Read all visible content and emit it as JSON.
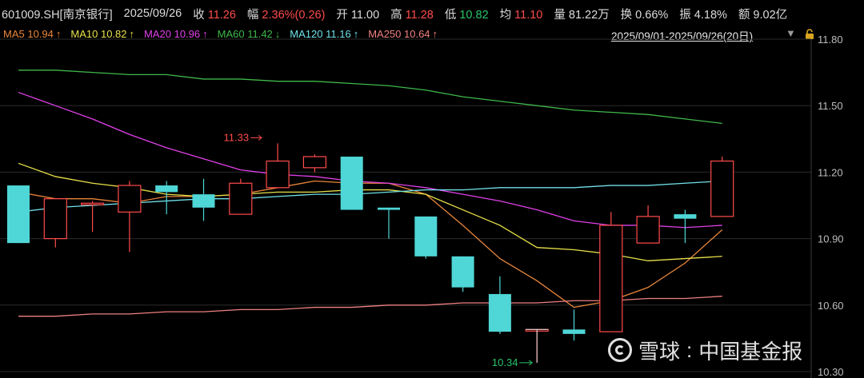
{
  "header": {
    "code": "601009.SH[南京银行]",
    "date": "2025/09/26",
    "close_label": "收",
    "close": "11.26",
    "change_label": "幅",
    "change": "2.36%(0.26)",
    "open_label": "开",
    "open": "11.00",
    "high_label": "高",
    "high": "11.28",
    "low_label": "低",
    "low": "10.82",
    "avg_label": "均",
    "avg": "11.10",
    "volume_label": "量",
    "volume": "81.22万",
    "turnover_label": "换",
    "turnover": "0.66%",
    "amplitude_label": "振",
    "amplitude": "4.18%",
    "amount_label": "额",
    "amount": "9.02亿"
  },
  "ma_legend": [
    {
      "label": "MA5",
      "value": "10.94",
      "arrow": "↑",
      "color": "#e8853a"
    },
    {
      "label": "MA10",
      "value": "10.82",
      "arrow": "↑",
      "color": "#e8e04a"
    },
    {
      "label": "MA20",
      "value": "10.96",
      "arrow": "↑",
      "color": "#e040e8"
    },
    {
      "label": "MA60",
      "value": "11.42",
      "arrow": "↓",
      "color": "#3fb84a"
    },
    {
      "label": "MA120",
      "value": "11.16",
      "arrow": "↑",
      "color": "#6fe0e8"
    },
    {
      "label": "MA250",
      "value": "10.64",
      "arrow": "↑",
      "color": "#f08080"
    }
  ],
  "range_label": "2025/09/01-2025/09/26(20日)",
  "watermark": {
    "brand": "雪球",
    "separator": ":",
    "source": "中国基金报"
  },
  "colors": {
    "up": "#ff4b4b",
    "down": "#4fd6d6",
    "grid": "#2a2a2a",
    "axis_text": "#bdbdbd"
  },
  "chart_data": {
    "type": "candlestick",
    "y_ticks": [
      11.8,
      11.5,
      11.2,
      10.9,
      10.6,
      10.3
    ],
    "ylim": [
      10.3,
      11.8
    ],
    "candles": [
      {
        "o": 11.14,
        "h": 11.14,
        "l": 10.88,
        "c": 10.88
      },
      {
        "o": 10.9,
        "h": 11.08,
        "l": 10.86,
        "c": 11.08
      },
      {
        "o": 11.06,
        "h": 11.07,
        "l": 10.93,
        "c": 11.06
      },
      {
        "o": 11.02,
        "h": 11.16,
        "l": 10.84,
        "c": 11.14
      },
      {
        "o": 11.14,
        "h": 11.16,
        "l": 11.01,
        "c": 11.11
      },
      {
        "o": 11.1,
        "h": 11.17,
        "l": 10.98,
        "c": 11.04
      },
      {
        "o": 11.01,
        "h": 11.17,
        "l": 11.01,
        "c": 11.15
      },
      {
        "o": 11.13,
        "h": 11.33,
        "l": 11.13,
        "c": 11.25
      },
      {
        "o": 11.22,
        "h": 11.28,
        "l": 11.2,
        "c": 11.27
      },
      {
        "o": 11.27,
        "h": 11.27,
        "l": 11.03,
        "c": 11.03
      },
      {
        "o": 11.04,
        "h": 11.04,
        "l": 10.9,
        "c": 11.03
      },
      {
        "o": 11.0,
        "h": 11.0,
        "l": 10.81,
        "c": 10.82
      },
      {
        "o": 10.82,
        "h": 10.82,
        "l": 10.66,
        "c": 10.68
      },
      {
        "o": 10.65,
        "h": 10.73,
        "l": 10.47,
        "c": 10.48
      },
      {
        "o": 10.49,
        "h": 10.49,
        "l": 10.34,
        "c": 10.49
      },
      {
        "o": 10.49,
        "h": 10.58,
        "l": 10.44,
        "c": 10.47
      },
      {
        "o": 10.48,
        "h": 11.02,
        "l": 10.48,
        "c": 10.96
      },
      {
        "o": 10.88,
        "h": 11.05,
        "l": 10.88,
        "c": 11.0
      },
      {
        "o": 11.01,
        "h": 11.03,
        "l": 10.88,
        "c": 10.99
      },
      {
        "o": 11.0,
        "h": 11.27,
        "l": 11.0,
        "c": 11.25
      }
    ],
    "ma": {
      "MA5": [
        11.11,
        11.08,
        11.08,
        11.06,
        11.09,
        11.09,
        11.1,
        11.13,
        11.16,
        11.15,
        11.15,
        11.1,
        10.96,
        10.81,
        10.71,
        10.59,
        10.62,
        10.68,
        10.79,
        10.94
      ],
      "MA10": [
        11.24,
        11.18,
        11.15,
        11.13,
        11.1,
        11.09,
        11.1,
        11.11,
        11.11,
        11.12,
        11.12,
        11.1,
        11.03,
        10.96,
        10.86,
        10.85,
        10.83,
        10.8,
        10.81,
        10.82
      ],
      "MA20": [
        11.56,
        11.5,
        11.44,
        11.37,
        11.31,
        11.26,
        11.21,
        11.19,
        11.18,
        11.16,
        11.15,
        11.13,
        11.1,
        11.07,
        11.03,
        10.98,
        10.96,
        10.96,
        10.95,
        10.96
      ],
      "MA60": [
        11.66,
        11.66,
        11.65,
        11.64,
        11.64,
        11.62,
        11.62,
        11.61,
        11.61,
        11.6,
        11.59,
        11.57,
        11.54,
        11.52,
        11.5,
        11.48,
        11.47,
        11.46,
        11.44,
        11.42
      ],
      "MA120": [
        11.02,
        11.04,
        11.05,
        11.06,
        11.07,
        11.08,
        11.08,
        11.09,
        11.1,
        11.1,
        11.11,
        11.12,
        11.12,
        11.13,
        11.13,
        11.13,
        11.14,
        11.14,
        11.15,
        11.16
      ],
      "MA250": [
        10.55,
        10.55,
        10.56,
        10.56,
        10.57,
        10.57,
        10.58,
        10.58,
        10.59,
        10.59,
        10.6,
        10.6,
        10.61,
        10.61,
        10.61,
        10.62,
        10.62,
        10.63,
        10.63,
        10.64
      ]
    },
    "annotations": [
      {
        "text": "11.33",
        "index": 7,
        "value": 11.33,
        "color": "#ff4b4b"
      },
      {
        "text": "10.34",
        "index": 14,
        "value": 10.34,
        "color": "#29c46b"
      }
    ]
  }
}
